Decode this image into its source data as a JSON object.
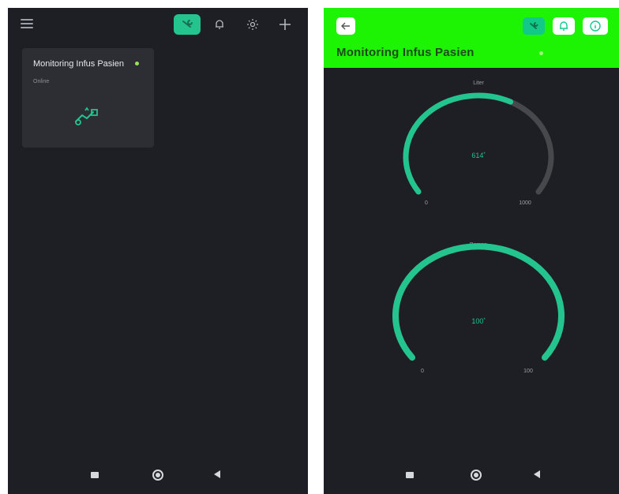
{
  "colors": {
    "accent": "#23c48e",
    "header_green": "#1cf404",
    "background": "#1d1f24",
    "card": "#2c2e34",
    "online_dot": "#9be15d"
  },
  "left_screen": {
    "header": {
      "icons": [
        "menu-icon",
        "wrench-icon",
        "bell-icon",
        "sun-icon",
        "plus-icon"
      ]
    },
    "device_card": {
      "title": "Monitoring Infus Pasien",
      "status": "Online",
      "icon": "iv-device-icon"
    }
  },
  "right_screen": {
    "header": {
      "title": "Monitoring Infus Pasien",
      "icons": [
        "back-arrow-icon",
        "wrench-icon",
        "bell-icon",
        "info-icon"
      ]
    },
    "gauges": [
      {
        "label": "Liter",
        "value": "614",
        "unit": "*",
        "numeric": 614,
        "min": "0",
        "max": "1000",
        "min_num": 0,
        "max_num": 1000
      },
      {
        "label": "Persen",
        "value": "100",
        "unit": "*",
        "numeric": 100,
        "min": "0",
        "max": "100",
        "min_num": 0,
        "max_num": 100
      }
    ]
  },
  "navbar": {
    "icons": [
      "recent-apps-icon",
      "home-icon",
      "back-icon"
    ]
  }
}
